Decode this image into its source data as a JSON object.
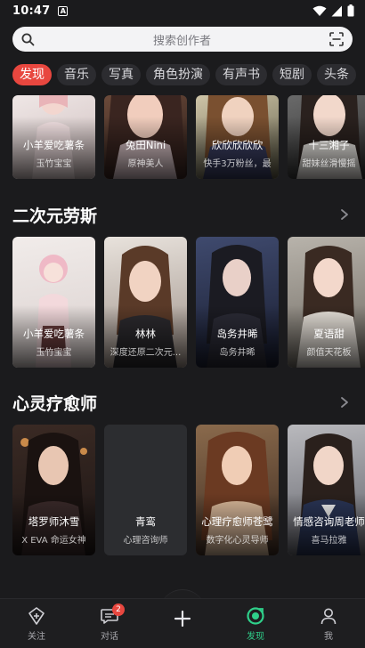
{
  "status_bar": {
    "time": "10:47",
    "notification_letter": "A"
  },
  "search": {
    "placeholder": "搜索创作者"
  },
  "tabs": [
    {
      "label": "发现",
      "active": true
    },
    {
      "label": "音乐",
      "active": false
    },
    {
      "label": "写真",
      "active": false
    },
    {
      "label": "角色扮演",
      "active": false
    },
    {
      "label": "有声书",
      "active": false
    },
    {
      "label": "短剧",
      "active": false
    },
    {
      "label": "头条",
      "active": false
    }
  ],
  "top_row": [
    {
      "name": "小羊爱吃薯条",
      "sub": "玉竹宝宝"
    },
    {
      "name": "兔田Nini",
      "sub": "原神美人"
    },
    {
      "name": "欣欣欣欣欣",
      "sub": "快手3万粉丝，最"
    },
    {
      "name": "十三湘子",
      "sub": "甜妹丝滑慢摇"
    }
  ],
  "sections": [
    {
      "title": "二次元劳斯",
      "cards": [
        {
          "name": "小羊爱吃薯条",
          "sub": "玉竹宝宝"
        },
        {
          "name": "林林",
          "sub": "深度还原二次元..."
        },
        {
          "name": "岛务井晞",
          "sub": "岛务井晞"
        },
        {
          "name": "夏语甜",
          "sub": "颜值天花板"
        }
      ]
    },
    {
      "title": "心灵疗愈师",
      "cards": [
        {
          "name": "塔罗师沐雪",
          "sub": "X EVA 命运女神"
        },
        {
          "name": "青鸾",
          "sub": "心理咨询师"
        },
        {
          "name": "心理疗愈师苍鹭",
          "sub": "数字化心灵导师"
        },
        {
          "name": "情感咨询周老师",
          "sub": "喜马拉雅"
        }
      ]
    }
  ],
  "bottom_nav": [
    {
      "label": "关注",
      "icon": "follow-icon"
    },
    {
      "label": "对话",
      "icon": "chat-icon",
      "badge": "2"
    },
    {
      "label": "",
      "icon": "plus-icon"
    },
    {
      "label": "发现",
      "icon": "discover-icon",
      "active": true
    },
    {
      "label": "我",
      "icon": "profile-icon"
    }
  ],
  "colors": {
    "accent_red": "#e8473f",
    "accent_green": "#2fd08a",
    "background": "#1b1b1d"
  }
}
